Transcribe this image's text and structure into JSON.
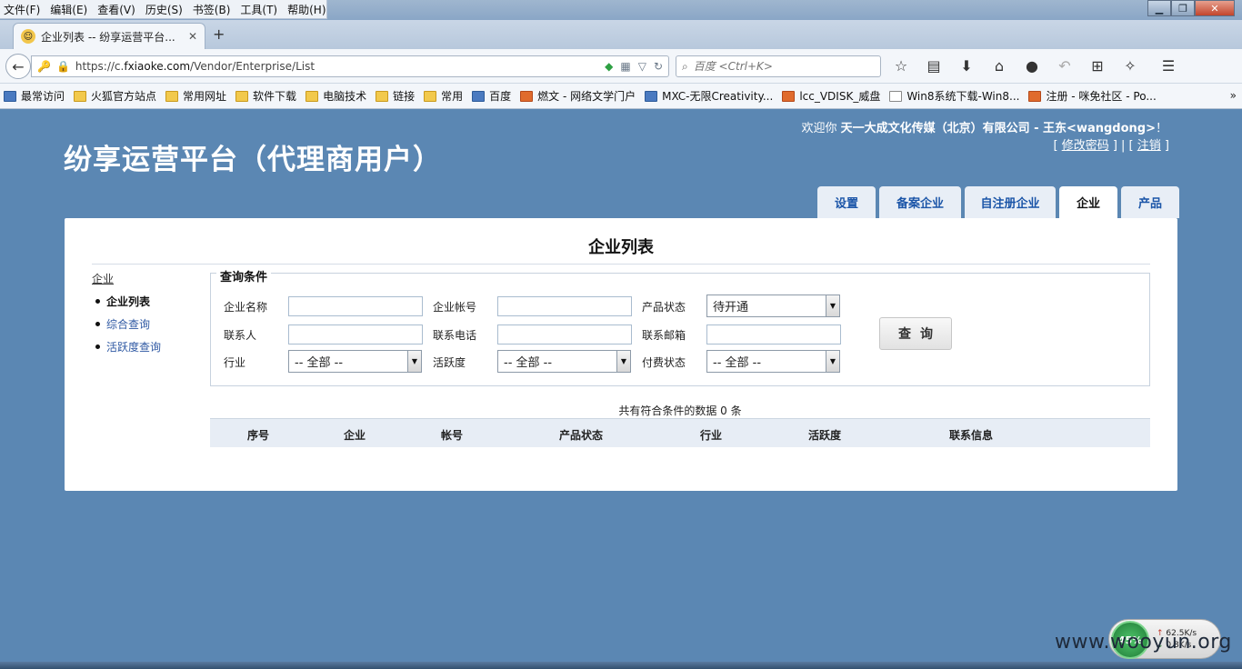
{
  "menubar": [
    "文件(F)",
    "编辑(E)",
    "查看(V)",
    "历史(S)",
    "书签(B)",
    "工具(T)",
    "帮助(H)"
  ],
  "browser": {
    "tab_title": "企业列表 -- 纷享运营平台...",
    "url_prefix": "https://c.",
    "url_domain": "fxiaoke.com",
    "url_path": "/Vendor/Enterprise/List",
    "search_placeholder": "百度 <Ctrl+K>"
  },
  "bookmarks": [
    {
      "label": "最常访问",
      "icon": "alt"
    },
    {
      "label": "火狐官方站点",
      "icon": "folder"
    },
    {
      "label": "常用网址",
      "icon": "folder"
    },
    {
      "label": "软件下载",
      "icon": "folder"
    },
    {
      "label": "电脑技术",
      "icon": "folder"
    },
    {
      "label": "链接",
      "icon": "folder"
    },
    {
      "label": "常用",
      "icon": "folder"
    },
    {
      "label": "百度",
      "icon": "alt"
    },
    {
      "label": "燃文 - 网络文学门户",
      "icon": "red"
    },
    {
      "label": "MXC-无限Creativity...",
      "icon": "alt"
    },
    {
      "label": "lcc_VDISK_威盘",
      "icon": "red"
    },
    {
      "label": "Win8系统下载-Win8...",
      "icon": "blank"
    },
    {
      "label": "注册 - 咪免社区 - Po...",
      "icon": "red"
    }
  ],
  "header": {
    "welcome_prefix": "欢迎你",
    "welcome_company": "天一大成文化传媒（北京）有限公司 - 王东<wangdong>",
    "welcome_suffix": "！",
    "change_password": "修改密码",
    "logout": "注销",
    "site_title": "纷享运营平台（代理商用户）"
  },
  "navtabs": [
    {
      "label": "设置",
      "active": false
    },
    {
      "label": "备案企业",
      "active": false
    },
    {
      "label": "自注册企业",
      "active": false
    },
    {
      "label": "企业",
      "active": true
    },
    {
      "label": "产品",
      "active": false
    }
  ],
  "panel": {
    "title": "企业列表",
    "sidenav": {
      "head": "企业",
      "items": [
        "企业列表",
        "综合查询",
        "活跃度查询"
      ]
    },
    "filter": {
      "legend": "查询条件",
      "labels": {
        "name": "企业名称",
        "account": "企业帐号",
        "product_status": "产品状态",
        "contact": "联系人",
        "phone": "联系电话",
        "email": "联系邮箱",
        "industry": "行业",
        "activity": "活跃度",
        "pay_status": "付费状态"
      },
      "product_status_value": "待开通",
      "industry_value": "-- 全部 --",
      "activity_value": "-- 全部 --",
      "pay_status_value": "-- 全部 --",
      "query_button": "查询"
    },
    "result_count": "共有符合条件的数据 0 条",
    "columns": [
      "序号",
      "企业",
      "帐号",
      "产品状态",
      "行业",
      "活跃度",
      "联系信息"
    ]
  },
  "netwidget": {
    "percent": "45%",
    "up": "62.5K/s",
    "down": "0.8K/s"
  },
  "watermark": "www.wooyun.org"
}
